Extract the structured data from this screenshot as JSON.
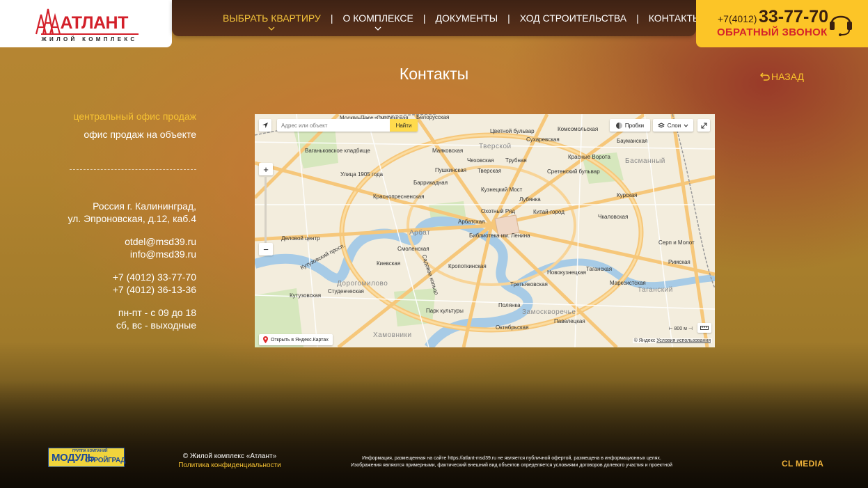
{
  "logo": {
    "name": "АТЛАНТ",
    "subtitle": "ЖИЛОЙ КОМПЛЕКС"
  },
  "nav": {
    "items": [
      {
        "label": "ВЫБРАТЬ КВАРТИРУ",
        "active": true,
        "has_dropdown": true
      },
      {
        "label": "О КОМПЛЕКСЕ",
        "active": false,
        "has_dropdown": true
      },
      {
        "label": "ДОКУМЕНТЫ",
        "active": false,
        "has_dropdown": false
      },
      {
        "label": "ХОД СТРОИТЕЛЬСТВА",
        "active": false,
        "has_dropdown": false
      },
      {
        "label": "КОНТАКТЫ",
        "active": false,
        "has_dropdown": false
      }
    ],
    "separator": "|"
  },
  "phone": {
    "prefix": "+7(4012)",
    "number": "33-77-70",
    "callback": "ОБРАТНЫЙ ЗВОНОК"
  },
  "page": {
    "title": "Контакты",
    "back": "НАЗАД"
  },
  "sidebar": {
    "office_central": "центральный офис продаж",
    "office_site": "офис продаж на объекте",
    "address": [
      "Россия г. Калининград,",
      "ул. Эпроновская, д.12, каб.4"
    ],
    "emails": [
      "otdel@msd39.ru",
      "info@msd39.ru"
    ],
    "phones": [
      "+7 (4012) 33-77-70",
      "+7 (4012) 36-13-36"
    ],
    "hours": [
      "пн-пт - с 09 до 18",
      "сб, вс - выходные"
    ]
  },
  "map": {
    "search_placeholder": "Адрес или объект",
    "find_button": "Найти",
    "traffic": "Пробки",
    "layers": "Слои",
    "zoom_in": "+",
    "zoom_out": "−",
    "open_in": "Открыть в Яндекс.Картах",
    "copyright": "© Яндекс",
    "terms": "Условия использования",
    "scale": "800 м",
    "labels": {
      "tverskoy": "Тверской",
      "basmanny": "Басманный",
      "arbat": "Арбат",
      "dorogomilovo": "Дорогомилово",
      "zamoskvorechye": "Замоскворечье",
      "khamovniki": "Хамовники",
      "taganskiy": "Таганский",
      "belorusskaya": "Белорусская",
      "mayakovskaya": "Маяковская",
      "pushkinskaya": "Пушкинская",
      "chekhovskaya": "Чеховская",
      "tverskaya": "Тверская",
      "trubnaya": "Трубная",
      "sukharevskaya": "Сухаревская",
      "komsomolskaya": "Комсомольская",
      "krasnye_vorota": "Красные Ворота",
      "kurskaya": "Курская",
      "kitay_gorod": "Китай-город",
      "lubyanka": "Лубянка",
      "okhotny_ryad": "Охотный Ряд",
      "biblioteka": "Библиотека им. Ленина",
      "arbatskaya": "Арбатская",
      "smolenskaya": "Смоленская",
      "kievskaya": "Киевская",
      "kropotkinskaya": "Кропоткинская",
      "park_kultury": "Парк культуры",
      "oktyabrskaya": "Октябрьская",
      "tretyakovskaya": "Третьяковская",
      "novokuznetskaya": "Новокузнецкая",
      "paveletskaya": "Павелецкая",
      "taganskaya": "Таганская",
      "marksistskaya": "Марксистская",
      "polyanka": "Полянка",
      "barrikadnaya": "Баррикадная",
      "krasnopresnenskaya": "Краснопресненская",
      "kutuzovskaya": "Кутузовская",
      "studencheskaya": "Студенческая",
      "delovoy_tsentr": "Деловой центр",
      "vagankovskoe": "Ваганьковское кладбище",
      "ulitsa_1905": "Улица 1905 года",
      "tsvetnoy": "Цветной бульвар",
      "sretenskiy": "Сретенский бульвар",
      "kuznetskiy": "Кузнецкий Мост",
      "chkalovskaya": "Чкаловская",
      "baumanskaya": "Бауманская",
      "moskva_pass": "Москва-Пасс.-Смоленская",
      "kutuzovsky_prosp": "Кутузовский просп.",
      "sadovoe_koltso": "Садовое кольцо",
      "serp_molot": "Серп и Молот",
      "rimskaya": "Римская"
    }
  },
  "footer": {
    "partner_group": "ГРУППА КОМПАНИЙ",
    "partner_name": "МОДУЛЬ",
    "partner_name2": "СТРОЙГРАД",
    "copyright": "© Жилой комплекс «Атлант»",
    "privacy": "Политика конфиденциальности",
    "disclaimer1": "Информация, размещенная на сайте https://atlant-msd39.ru не является публичной офертой, размещена в информационных целях.",
    "disclaimer2": "Изображения являются примерными, фактический внешний вид объектов определяется условиями договоров долевого участия и проектной",
    "developer": "CL MEDIA"
  }
}
